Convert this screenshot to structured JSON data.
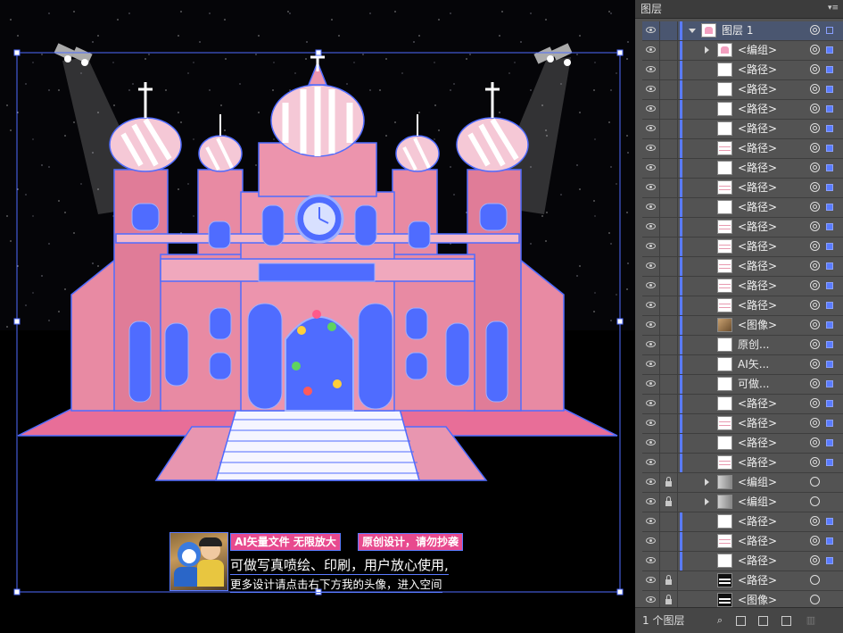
{
  "canvas": {
    "info_box": {
      "badge1": "AI矢量文件 无限放大",
      "badge2": "原创设计，请勿抄袭",
      "line1": "可做写真喷绘、印刷，用户放心使用,",
      "line2": "更多设计请点击右下方我的头像，进入空间"
    },
    "colors": {
      "castle_pink": "#e88aa3",
      "selection_blue": "#4f6cff",
      "floor_pink": "#e86e98"
    }
  },
  "panel": {
    "tab_label": "图层",
    "menu_icon": "▾≡",
    "rows": [
      {
        "name": "图层 1",
        "type": "layer",
        "expand": "down",
        "thumb": "pink",
        "lock": false,
        "indent": 0,
        "target": "sel",
        "selected": "filled"
      },
      {
        "name": "<编组>",
        "type": "group",
        "expand": "right",
        "thumb": "pink",
        "lock": false,
        "indent": 1,
        "target": "sel",
        "selected": "filled"
      },
      {
        "name": "<路径>",
        "type": "path",
        "thumb": "white",
        "lock": false,
        "indent": 1,
        "target": "sel",
        "selected": "filled"
      },
      {
        "name": "<路径>",
        "type": "path",
        "thumb": "white",
        "lock": false,
        "indent": 1,
        "target": "sel",
        "selected": "filled"
      },
      {
        "name": "<路径>",
        "type": "path",
        "thumb": "white",
        "lock": false,
        "indent": 1,
        "target": "sel",
        "selected": "filled"
      },
      {
        "name": "<路径>",
        "type": "path",
        "thumb": "white",
        "lock": false,
        "indent": 1,
        "target": "sel",
        "selected": "filled"
      },
      {
        "name": "<路径>",
        "type": "path",
        "thumb": "lines",
        "lock": false,
        "indent": 1,
        "target": "sel",
        "selected": "filled"
      },
      {
        "name": "<路径>",
        "type": "path",
        "thumb": "white",
        "lock": false,
        "indent": 1,
        "target": "sel",
        "selected": "filled"
      },
      {
        "name": "<路径>",
        "type": "path",
        "thumb": "lines",
        "lock": false,
        "indent": 1,
        "target": "sel",
        "selected": "filled"
      },
      {
        "name": "<路径>",
        "type": "path",
        "thumb": "white",
        "lock": false,
        "indent": 1,
        "target": "sel",
        "selected": "filled"
      },
      {
        "name": "<路径>",
        "type": "path",
        "thumb": "lines",
        "lock": false,
        "indent": 1,
        "target": "sel",
        "selected": "filled"
      },
      {
        "name": "<路径>",
        "type": "path",
        "thumb": "lines",
        "lock": false,
        "indent": 1,
        "target": "sel",
        "selected": "filled"
      },
      {
        "name": "<路径>",
        "type": "path",
        "thumb": "lines",
        "lock": false,
        "indent": 1,
        "target": "sel",
        "selected": "filled"
      },
      {
        "name": "<路径>",
        "type": "path",
        "thumb": "lines",
        "lock": false,
        "indent": 1,
        "target": "sel",
        "selected": "filled"
      },
      {
        "name": "<路径>",
        "type": "path",
        "thumb": "lines",
        "lock": false,
        "indent": 1,
        "target": "sel",
        "selected": "filled"
      },
      {
        "name": "<图像>",
        "type": "image",
        "thumb": "photo",
        "lock": false,
        "indent": 1,
        "target": "sel",
        "selected": "filled"
      },
      {
        "name": "原创...",
        "type": "text",
        "thumb": "white",
        "lock": false,
        "indent": 1,
        "target": "sel",
        "selected": "filled"
      },
      {
        "name": "AI矢...",
        "type": "text",
        "thumb": "white",
        "lock": false,
        "indent": 1,
        "target": "sel",
        "selected": "filled"
      },
      {
        "name": "可做...",
        "type": "text",
        "thumb": "white",
        "lock": false,
        "indent": 1,
        "target": "sel",
        "selected": "filled"
      },
      {
        "name": "<路径>",
        "type": "path",
        "thumb": "white",
        "lock": false,
        "indent": 1,
        "target": "sel",
        "selected": "filled"
      },
      {
        "name": "<路径>",
        "type": "path",
        "thumb": "lines",
        "lock": false,
        "indent": 1,
        "target": "sel",
        "selected": "filled"
      },
      {
        "name": "<路径>",
        "type": "path",
        "thumb": "white",
        "lock": false,
        "indent": 1,
        "target": "sel",
        "selected": "filled"
      },
      {
        "name": "<路径>",
        "type": "path",
        "thumb": "lines",
        "lock": false,
        "indent": 1,
        "target": "sel",
        "selected": "filled"
      },
      {
        "name": "<编组>",
        "type": "group",
        "expand": "right",
        "thumb": "grp",
        "lock": true,
        "indent": 1,
        "target": "plain",
        "selected": "none"
      },
      {
        "name": "<编组>",
        "type": "group",
        "expand": "right",
        "thumb": "grp",
        "lock": true,
        "indent": 1,
        "target": "plain",
        "selected": "none"
      },
      {
        "name": "<路径>",
        "type": "path",
        "thumb": "white",
        "lock": false,
        "indent": 1,
        "target": "sel",
        "selected": "filled"
      },
      {
        "name": "<路径>",
        "type": "path",
        "thumb": "lines",
        "lock": false,
        "indent": 1,
        "target": "sel",
        "selected": "filled"
      },
      {
        "name": "<路径>",
        "type": "path",
        "thumb": "white",
        "lock": false,
        "indent": 1,
        "target": "sel",
        "selected": "filled"
      },
      {
        "name": "<路径>",
        "type": "path",
        "thumb": "black",
        "lock": true,
        "indent": 1,
        "target": "plain",
        "selected": "none"
      },
      {
        "name": "<图像>",
        "type": "image",
        "thumb": "black",
        "lock": true,
        "indent": 1,
        "target": "plain",
        "selected": "none"
      }
    ],
    "footer": {
      "layer_count": "1 个图层",
      "icons": [
        "locate-object-icon",
        "make-clipping-mask-icon",
        "create-sublayer-icon",
        "create-new-layer-icon",
        "delete-icon"
      ]
    }
  }
}
